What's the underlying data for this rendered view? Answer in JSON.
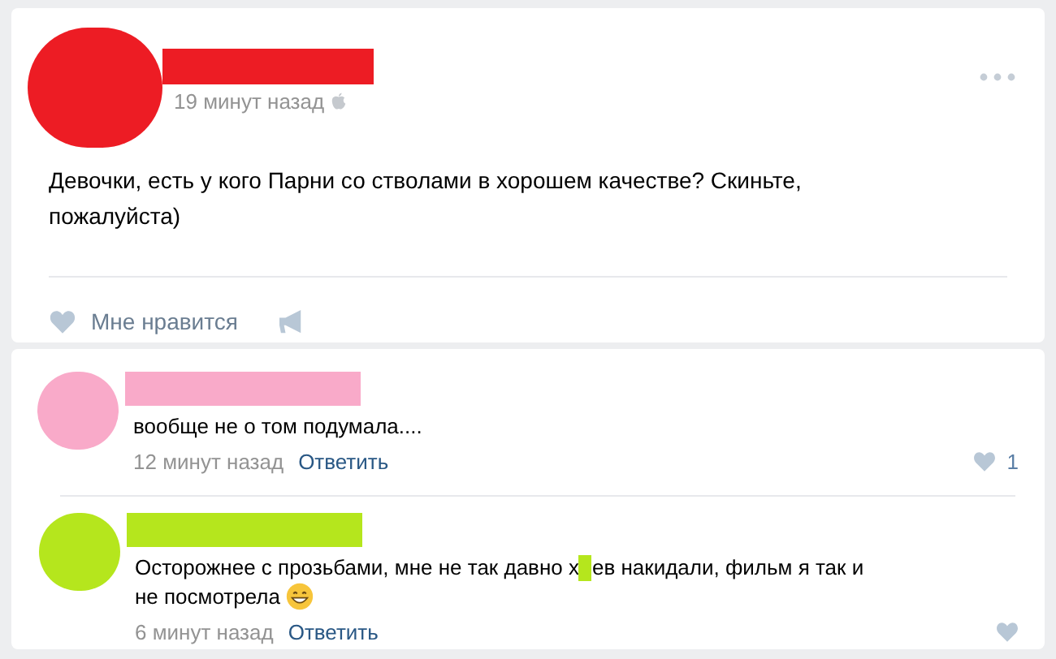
{
  "post": {
    "color": "#ed1c24",
    "time": "19 минут назад",
    "text": "Девочки, есть у кого Парни со стволами в хорошем качестве? Скиньте, пожалуйста)",
    "like_label": "Мне нравится"
  },
  "comments": [
    {
      "color": "#f9aac9",
      "lines": [
        [
          {
            "kind": "text",
            "text": "вообще не о том подумала...."
          }
        ]
      ],
      "time": "12 минут назад",
      "reply": "Ответить",
      "likes": "1"
    },
    {
      "color": "#b5e61d",
      "lines": [
        [
          {
            "kind": "text",
            "text": "Осторожнее с прозьбами, мне не так давно х"
          },
          {
            "kind": "redaction"
          },
          {
            "kind": "text",
            "text": "ев накидали, фильм я так и"
          }
        ],
        [
          {
            "kind": "text",
            "text": "не посмотрела"
          },
          {
            "kind": "emoji"
          }
        ]
      ],
      "time": "6 минут назад",
      "reply": "Ответить"
    }
  ]
}
